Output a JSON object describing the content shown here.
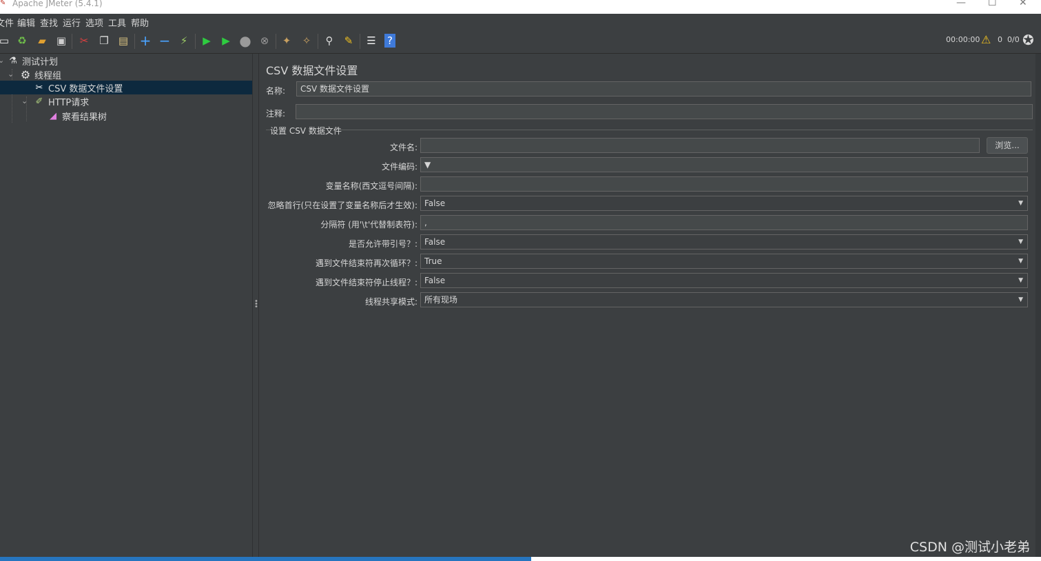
{
  "window": {
    "title": "Apache JMeter (5.4.1)",
    "minimize_glyph": "—",
    "maximize_glyph": "☐",
    "close_glyph": "✕"
  },
  "menu": [
    "文件",
    "编辑",
    "查找",
    "运行",
    "选项",
    "工具",
    "帮助"
  ],
  "toolbar": {
    "icons": [
      "new-icon",
      "templates-icon",
      "open-icon",
      "save-icon",
      "cut-icon",
      "copy-icon",
      "paste-icon",
      "expand-icon",
      "collapse-icon",
      "toggle-icon",
      "start-icon",
      "start-no-timers-icon",
      "stop-icon",
      "shutdown-icon",
      "clear-icon",
      "clear-all-icon",
      "search-icon",
      "reset-search-icon",
      "function-helper-icon",
      "help-icon"
    ],
    "timer": "00:00:00",
    "warning_count": "0",
    "threads": "0/0"
  },
  "tree": {
    "items": [
      {
        "label": "测试计划",
        "icon": "test-plan-icon"
      },
      {
        "label": "线程组",
        "icon": "gear-icon"
      },
      {
        "label": "CSV 数据文件设置",
        "icon": "tools-icon"
      },
      {
        "label": "HTTP请求",
        "icon": "pipette-icon"
      },
      {
        "label": "察看结果树",
        "icon": "graph-icon"
      }
    ],
    "selected_index": 2
  },
  "panel": {
    "title": "CSV 数据文件设置",
    "name_label": "名称:",
    "name_value": "CSV 数据文件设置",
    "comment_label": "注释:",
    "comment_value": "",
    "group_title": "设置 CSV 数据文件",
    "browse_label": "浏览...",
    "fields": [
      {
        "label": "文件名:",
        "value": "",
        "kind": "text"
      },
      {
        "label": "文件编码:",
        "value": "",
        "kind": "editable-combo"
      },
      {
        "label": "变量名称(西文逗号间隔):",
        "value": "",
        "kind": "text"
      },
      {
        "label": "忽略首行(只在设置了变量名称后才生效):",
        "value": "False",
        "kind": "combo"
      },
      {
        "label": "分隔符 (用'\\t'代替制表符):",
        "value": ",",
        "kind": "text"
      },
      {
        "label": "是否允许带引号？:",
        "value": "False",
        "kind": "combo"
      },
      {
        "label": "遇到文件结束符再次循环？:",
        "value": "True",
        "kind": "combo"
      },
      {
        "label": "遇到文件结束符停止线程？:",
        "value": "False",
        "kind": "combo"
      },
      {
        "label": "线程共享模式:",
        "value": "所有现场",
        "kind": "combo"
      }
    ]
  },
  "status": {
    "progress": 0.51
  },
  "watermark": "CSDN @测试小老弟",
  "colors": {
    "background": "#3c3f41",
    "selection": "#0d293e",
    "progress": "#2675bf"
  }
}
